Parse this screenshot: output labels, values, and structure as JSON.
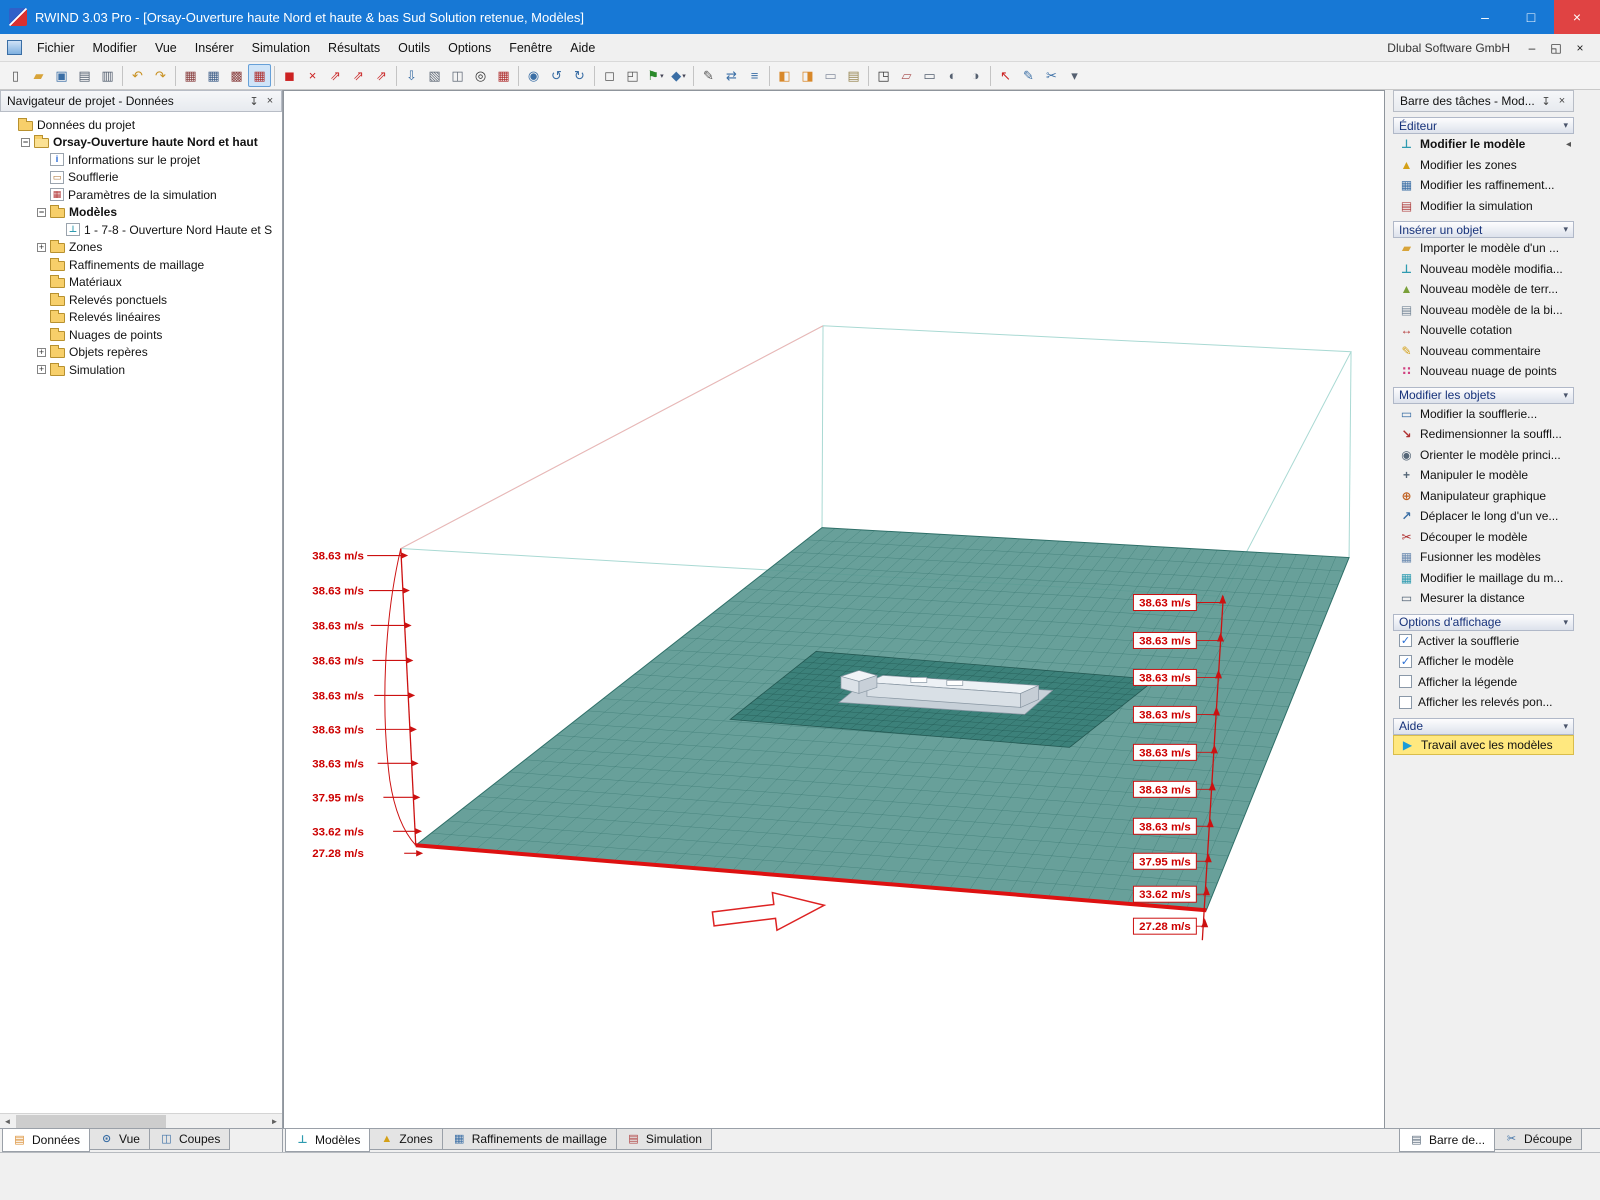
{
  "window": {
    "title": "RWIND 3.03 Pro - [Orsay-Ouverture haute Nord et haute & bas Sud Solution retenue, Modèles]"
  },
  "menubar": {
    "items": [
      "Fichier",
      "Modifier",
      "Vue",
      "Insérer",
      "Simulation",
      "Résultats",
      "Outils",
      "Options",
      "Fenêtre",
      "Aide"
    ],
    "right_text": "Dlubal Software GmbH"
  },
  "toolbar": {
    "groups": [
      [
        {
          "n": "new-file",
          "g": "▯",
          "c": "#555555"
        },
        {
          "n": "open-folder",
          "g": "▰",
          "c": "#d8a43a"
        },
        {
          "n": "save",
          "g": "▣",
          "c": "#3a6ea5"
        },
        {
          "n": "print-preview",
          "g": "▤",
          "c": "#556070"
        },
        {
          "n": "print",
          "g": "▥",
          "c": "#556070"
        }
      ],
      [
        {
          "n": "undo",
          "g": "↶",
          "c": "#c89020"
        },
        {
          "n": "redo",
          "g": "↷",
          "c": "#c89020"
        }
      ],
      [
        {
          "n": "table-zones",
          "g": "▦",
          "c": "#8a4040"
        },
        {
          "n": "table-refinements",
          "g": "▦",
          "c": "#40608a"
        },
        {
          "n": "table-results",
          "g": "▩",
          "c": "#8a4040"
        },
        {
          "n": "table-grid",
          "g": "▦",
          "c": "#b03030",
          "pressed": true
        }
      ],
      [
        {
          "n": "show-wind-simulation",
          "g": "◼",
          "c": "#cc2222"
        },
        {
          "n": "close-wind-simulation",
          "g": "×",
          "c": "#cc2222"
        },
        {
          "n": "wind-profile-x",
          "g": "⇗",
          "c": "#cc3333"
        },
        {
          "n": "wind-profile-y",
          "g": "⇗",
          "c": "#cc3333"
        },
        {
          "n": "wind-profile-z",
          "g": "⇗",
          "c": "#cc3333"
        }
      ],
      [
        {
          "n": "import-geometry",
          "g": "⇩",
          "c": "#3a6ea5"
        },
        {
          "n": "export-image",
          "g": "▧",
          "c": "#606a77"
        },
        {
          "n": "new-window",
          "g": "◫",
          "c": "#606a77"
        },
        {
          "n": "zoom-region",
          "g": "◎",
          "c": "#333333"
        },
        {
          "n": "zones-overlay",
          "g": "▦",
          "c": "#b03030"
        }
      ],
      [
        {
          "n": "zoom-dynamic",
          "g": "◉",
          "c": "#3a6ea5"
        },
        {
          "n": "rotate-left",
          "g": "↺",
          "c": "#3a6ea5"
        },
        {
          "n": "rotate-right",
          "g": "↻",
          "c": "#3a6ea5"
        }
      ],
      [
        {
          "n": "view-front",
          "g": "◻",
          "c": "#555555"
        },
        {
          "n": "view-isometric",
          "g": "◰",
          "c": "#555555"
        },
        {
          "n": "walk-mode",
          "g": "⚑",
          "c": "#2a8a2a",
          "dropdown": true
        },
        {
          "n": "view-direction",
          "g": "◆",
          "c": "#3a6ea5",
          "dropdown": true
        }
      ],
      [
        {
          "n": "clipping-plane",
          "g": "✎",
          "c": "#555555"
        },
        {
          "n": "move-object",
          "g": "⇄",
          "c": "#3a6ea5"
        },
        {
          "n": "shading-mode",
          "g": "≡",
          "c": "#3a6ea5"
        }
      ],
      [
        {
          "n": "dock-navigator",
          "g": "◧",
          "c": "#d8882a"
        },
        {
          "n": "dock-taskbar",
          "g": "◨",
          "c": "#d8882a"
        },
        {
          "n": "dock-panels",
          "g": "▭",
          "c": "#8890a0"
        },
        {
          "n": "paste-view",
          "g": "▤",
          "c": "#998855"
        }
      ],
      [
        {
          "n": "wireframe-box",
          "g": "◳",
          "c": "#333333"
        },
        {
          "n": "eraser",
          "g": "▱",
          "c": "#b06060"
        },
        {
          "n": "screen-capture",
          "g": "▭",
          "c": "#556070"
        },
        {
          "n": "transparency",
          "g": "◐",
          "c": "#556070"
        },
        {
          "n": "brightness",
          "g": "◑",
          "c": "#556070"
        }
      ],
      [
        {
          "n": "selection-pointer",
          "g": "↖",
          "c": "#cc2222"
        },
        {
          "n": "edit-properties",
          "g": "✎",
          "c": "#3a6ea5"
        },
        {
          "n": "display-settings",
          "g": "✂",
          "c": "#3a6ea5"
        },
        {
          "n": "toolbar-overflow",
          "g": "▾",
          "c": "#556070"
        }
      ]
    ]
  },
  "navigator": {
    "title": "Navigateur de projet - Données",
    "tree": [
      {
        "depth": 0,
        "icon": "folder",
        "label": "Données du projet"
      },
      {
        "depth": 1,
        "icon": "folder-open",
        "label": "Orsay-Ouverture haute Nord et haut",
        "bold": true,
        "expander": "minus"
      },
      {
        "depth": 2,
        "icon": "project-info",
        "label": "Informations sur le projet"
      },
      {
        "depth": 2,
        "icon": "wind-tunnel",
        "label": "Soufflerie"
      },
      {
        "depth": 2,
        "icon": "simulation-params",
        "label": "Paramètres de la simulation"
      },
      {
        "depth": 2,
        "icon": "folder",
        "label": "Modèles",
        "bold": true,
        "expander": "minus"
      },
      {
        "depth": 3,
        "icon": "model",
        "label": "1 - 7-8 - Ouverture Nord Haute et S"
      },
      {
        "depth": 2,
        "icon": "folder",
        "label": "Zones",
        "expander": "plus"
      },
      {
        "depth": 2,
        "icon": "folder",
        "label": "Raffinements de maillage"
      },
      {
        "depth": 2,
        "icon": "folder",
        "label": "Matériaux"
      },
      {
        "depth": 2,
        "icon": "folder",
        "label": "Relevés ponctuels"
      },
      {
        "depth": 2,
        "icon": "folder",
        "label": "Relevés linéaires"
      },
      {
        "depth": 2,
        "icon": "folder",
        "label": "Nuages de points"
      },
      {
        "depth": 2,
        "icon": "folder",
        "label": "Objets repères",
        "expander": "plus"
      },
      {
        "depth": 2,
        "icon": "folder",
        "label": "Simulation",
        "expander": "plus"
      }
    ],
    "tabs": [
      {
        "label": "Données",
        "icon": "data-tab",
        "active": true
      },
      {
        "label": "Vue",
        "icon": "view-tab"
      },
      {
        "label": "Coupes",
        "icon": "sections-tab"
      }
    ]
  },
  "viewport": {
    "velocity_profile_left": [
      "38.63 m/s",
      "38.63 m/s",
      "38.63 m/s",
      "38.63 m/s",
      "38.63 m/s",
      "38.63 m/s",
      "38.63 m/s",
      "37.95 m/s",
      "33.62 m/s",
      "27.28 m/s"
    ],
    "velocity_profile_right": [
      "38.63 m/s",
      "38.63 m/s",
      "38.63 m/s",
      "38.63 m/s",
      "38.63 m/s",
      "38.63 m/s",
      "38.63 m/s",
      "37.95 m/s",
      "33.62 m/s",
      "27.28 m/s"
    ],
    "tabs": [
      {
        "label": "Modèles",
        "icon": "models-tab",
        "active": true
      },
      {
        "label": "Zones",
        "icon": "zones-tab"
      },
      {
        "label": "Raffinements de maillage",
        "icon": "refinements-tab"
      },
      {
        "label": "Simulation",
        "icon": "simulation-tab"
      }
    ]
  },
  "taskbar": {
    "title": "Barre des tâches - Mod...",
    "sections": [
      {
        "title": "Éditeur",
        "items": [
          {
            "label": "Modifier le modèle",
            "icon": "edit-model",
            "selected": true
          },
          {
            "label": "Modifier les zones",
            "icon": "edit-zones"
          },
          {
            "label": "Modifier les raffinement...",
            "icon": "edit-refinements"
          },
          {
            "label": "Modifier la simulation",
            "icon": "edit-simulation"
          }
        ]
      },
      {
        "title": "Insérer un objet",
        "items": [
          {
            "label": "Importer le modèle d'un ...",
            "icon": "import-model"
          },
          {
            "label": "Nouveau modèle modifia...",
            "icon": "new-model"
          },
          {
            "label": "Nouveau modèle de terr...",
            "icon": "new-terrain"
          },
          {
            "label": "Nouveau modèle de la bi...",
            "icon": "new-library-model"
          },
          {
            "label": "Nouvelle cotation",
            "icon": "new-dimension"
          },
          {
            "label": "Nouveau commentaire",
            "icon": "new-comment"
          },
          {
            "label": "Nouveau nuage de points",
            "icon": "new-pointcloud"
          }
        ]
      },
      {
        "title": "Modifier les objets",
        "items": [
          {
            "label": "Modifier la soufflerie...",
            "icon": "edit-windtunnel"
          },
          {
            "label": "Redimensionner la souffl...",
            "icon": "resize-windtunnel"
          },
          {
            "label": "Orienter le modèle princi...",
            "icon": "orient-model"
          },
          {
            "label": "Manipuler le modèle",
            "icon": "manipulate-model"
          },
          {
            "label": "Manipulateur graphique",
            "icon": "graphic-manipulator"
          },
          {
            "label": "Déplacer le long d'un ve...",
            "icon": "move-along-vector"
          },
          {
            "label": "Découper le modèle",
            "icon": "cut-model"
          },
          {
            "label": "Fusionner les modèles",
            "icon": "merge-models"
          },
          {
            "label": "Modifier le maillage du m...",
            "icon": "edit-mesh"
          },
          {
            "label": "Mesurer la distance",
            "icon": "measure-distance"
          }
        ]
      },
      {
        "title": "Options d'affichage",
        "items": [
          {
            "label": "Activer la soufflerie",
            "checkbox": true,
            "checked": true
          },
          {
            "label": "Afficher le modèle",
            "checkbox": true,
            "checked": true
          },
          {
            "label": "Afficher la légende",
            "checkbox": true,
            "checked": false
          },
          {
            "label": "Afficher les relevés pon...",
            "checkbox": true,
            "checked": false
          }
        ]
      },
      {
        "title": "Aide",
        "items": [
          {
            "label": "Travail avec les modèles",
            "icon": "help-models",
            "highlight": true
          }
        ]
      }
    ],
    "tabs": [
      {
        "label": "Barre de...",
        "icon": "taskbar-tab",
        "active": true
      },
      {
        "label": "Découpe",
        "icon": "decoupe-tab"
      }
    ]
  },
  "icons": {
    "window-minimize": {
      "glyph": "–",
      "color": "#ffffff"
    },
    "window-maximize": {
      "glyph": "□",
      "color": "#ffffff"
    },
    "window-close": {
      "glyph": "×",
      "color": "#ffffff"
    },
    "child-minimize": {
      "glyph": "–",
      "color": "#222222"
    },
    "child-restore": {
      "glyph": "◱",
      "color": "#222222"
    },
    "child-close": {
      "glyph": "×",
      "color": "#222222"
    },
    "pin": {
      "glyph": "↧",
      "color": "#444444"
    },
    "panel-close": {
      "glyph": "×",
      "color": "#444444"
    },
    "scroll-left": {
      "glyph": "◄",
      "color": "#606060"
    },
    "scroll-right": {
      "glyph": "►",
      "color": "#606060"
    },
    "section-dropdown": {
      "glyph": "▾",
      "color": "#49536a"
    },
    "selected-marker": {
      "glyph": "◂",
      "color": "#555555"
    },
    "checkbox-check": {
      "glyph": "✓",
      "color": "#2a6fd4"
    },
    "project-info": {
      "glyph": "i",
      "color": "#1a5fd4",
      "boxed": true
    },
    "wind-tunnel": {
      "glyph": "▭",
      "color": "#a86a2a",
      "boxed": true
    },
    "simulation-params": {
      "glyph": "▦",
      "color": "#b03030",
      "boxed": true
    },
    "model": {
      "glyph": "⊥",
      "color": "#2e9bb0",
      "boxed": true
    },
    "data-tab": {
      "glyph": "▤",
      "color": "#d8882a"
    },
    "view-tab": {
      "glyph": "⊙",
      "color": "#3a6ea5"
    },
    "sections-tab": {
      "glyph": "◫",
      "color": "#3a6ea5"
    },
    "models-tab": {
      "glyph": "⊥",
      "color": "#2e9bb0"
    },
    "zones-tab": {
      "glyph": "▲",
      "color": "#d4a017"
    },
    "refinements-tab": {
      "glyph": "▦",
      "color": "#3a6ea5"
    },
    "simulation-tab": {
      "glyph": "▤",
      "color": "#b04040"
    },
    "taskbar-tab": {
      "glyph": "▤",
      "color": "#556677"
    },
    "decoupe-tab": {
      "glyph": "✂",
      "color": "#3a6ea5"
    },
    "edit-model": {
      "glyph": "⊥",
      "color": "#2e9bb0"
    },
    "edit-zones": {
      "glyph": "▲",
      "color": "#d4a017"
    },
    "edit-refinements": {
      "glyph": "▦",
      "color": "#3a6ea5"
    },
    "edit-simulation": {
      "glyph": "▤",
      "color": "#b04040"
    },
    "import-model": {
      "glyph": "▰",
      "color": "#d8a43a"
    },
    "new-model": {
      "glyph": "⊥",
      "color": "#2e9bb0"
    },
    "new-terrain": {
      "glyph": "▲",
      "color": "#7aa03a"
    },
    "new-library-model": {
      "glyph": "▤",
      "color": "#778899"
    },
    "new-dimension": {
      "glyph": "↔",
      "color": "#b03030"
    },
    "new-comment": {
      "glyph": "✎",
      "color": "#d4a017"
    },
    "new-pointcloud": {
      "glyph": "∷",
      "color": "#d04080"
    },
    "edit-windtunnel": {
      "glyph": "▭",
      "color": "#3a6ea5"
    },
    "resize-windtunnel": {
      "glyph": "↘",
      "color": "#b03030"
    },
    "orient-model": {
      "glyph": "◉",
      "color": "#556677"
    },
    "manipulate-model": {
      "glyph": "+",
      "color": "#556677"
    },
    "graphic-manipulator": {
      "glyph": "⊕",
      "color": "#c06020"
    },
    "move-along-vector": {
      "glyph": "↗",
      "color": "#3a6ea5"
    },
    "cut-model": {
      "glyph": "✂",
      "color": "#b03030"
    },
    "merge-models": {
      "glyph": "▦",
      "color": "#6a8ab0"
    },
    "edit-mesh": {
      "glyph": "▦",
      "color": "#2e9bb0"
    },
    "measure-distance": {
      "glyph": "▭",
      "color": "#556677"
    },
    "help-models": {
      "glyph": "▶",
      "color": "#1a9cd8"
    }
  }
}
